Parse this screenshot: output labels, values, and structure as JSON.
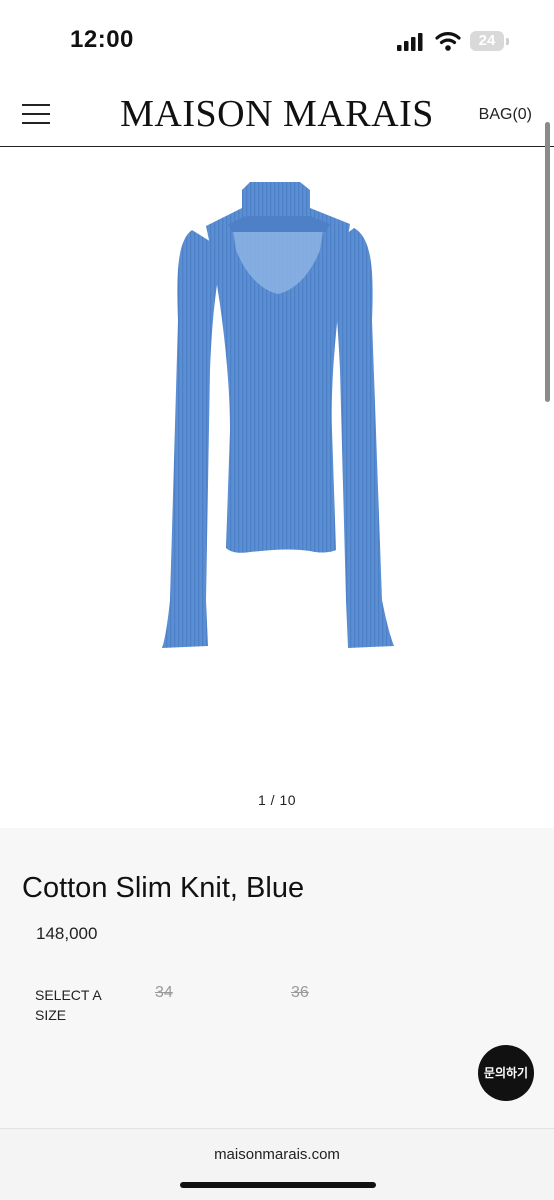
{
  "status_bar": {
    "time": "12:00",
    "battery_level": "24",
    "icons": [
      "signal-icon",
      "wifi-icon",
      "battery-icon"
    ]
  },
  "header": {
    "brand": "MAISON MARAIS",
    "bag_label": "BAG(0)",
    "menu_icon": "hamburger-menu-icon"
  },
  "gallery": {
    "counter": "1 / 10",
    "image_subject": "blue ribbed knit top with turtleneck and cutout"
  },
  "product": {
    "title": "Cotton Slim Knit, Blue",
    "price": "148,000",
    "size_label": "SELECT A SIZE",
    "sizes": [
      {
        "label": "34",
        "available": false
      },
      {
        "label": "36",
        "available": false
      }
    ]
  },
  "chat_button": {
    "label": "문의하기"
  },
  "browser": {
    "url": "maisonmarais.com"
  },
  "colors": {
    "knit_blue": "#5b8fd4",
    "chat_button_bg": "#111111",
    "info_panel_bg": "#f7f7f7"
  }
}
